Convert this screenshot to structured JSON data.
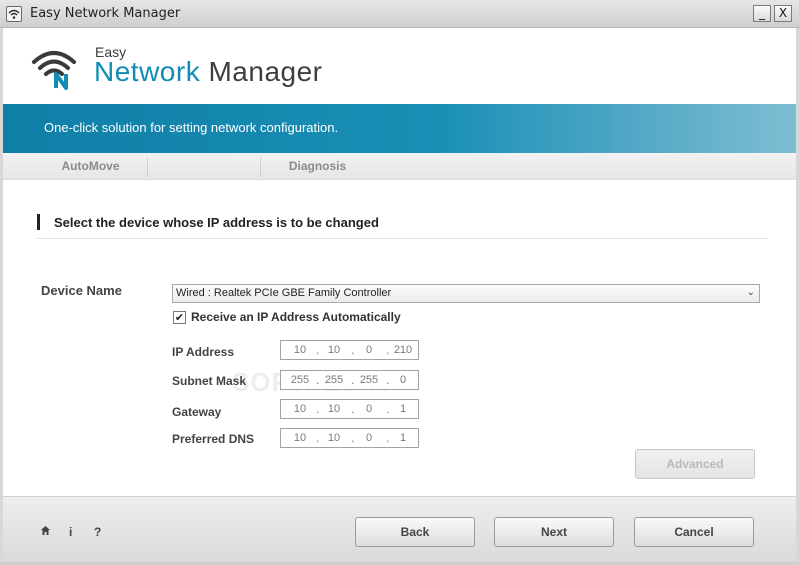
{
  "window": {
    "title": "Easy Network Manager",
    "minimize_glyph": "_",
    "close_glyph": "X"
  },
  "logo": {
    "small": "Easy",
    "word1": "Network",
    "word2": "Manager"
  },
  "banner": {
    "text": "One-click solution for setting network configuration."
  },
  "nav": {
    "tabs": [
      {
        "label": "AutoMove"
      },
      {
        "label": "Diagnosis"
      }
    ]
  },
  "section": {
    "title": "Select the device whose IP address is to be changed"
  },
  "device": {
    "label": "Device Name",
    "selected": "Wired : Realtek PCIe GBE Family Controller",
    "auto_ip_label": "Receive an IP Address Automatically",
    "auto_ip_checked": true
  },
  "fields": [
    {
      "label": "IP Address",
      "octets": [
        "10",
        "10",
        "0",
        "210"
      ]
    },
    {
      "label": "Subnet Mask",
      "octets": [
        "255",
        "255",
        "255",
        "0"
      ]
    },
    {
      "label": "Gateway",
      "octets": [
        "10",
        "10",
        "0",
        "1"
      ]
    },
    {
      "label": "Preferred DNS",
      "octets": [
        "10",
        "10",
        "0",
        "1"
      ]
    }
  ],
  "buttons": {
    "advanced": "Advanced",
    "back": "Back",
    "next": "Next",
    "cancel": "Cancel"
  },
  "footer": {
    "home_glyph": "🏠",
    "info_glyph": "i",
    "help_glyph": "?"
  },
  "watermark": "SOFTPEDIA",
  "colors": {
    "accent": "#0f8db4",
    "banner": "#1a8fb6"
  }
}
